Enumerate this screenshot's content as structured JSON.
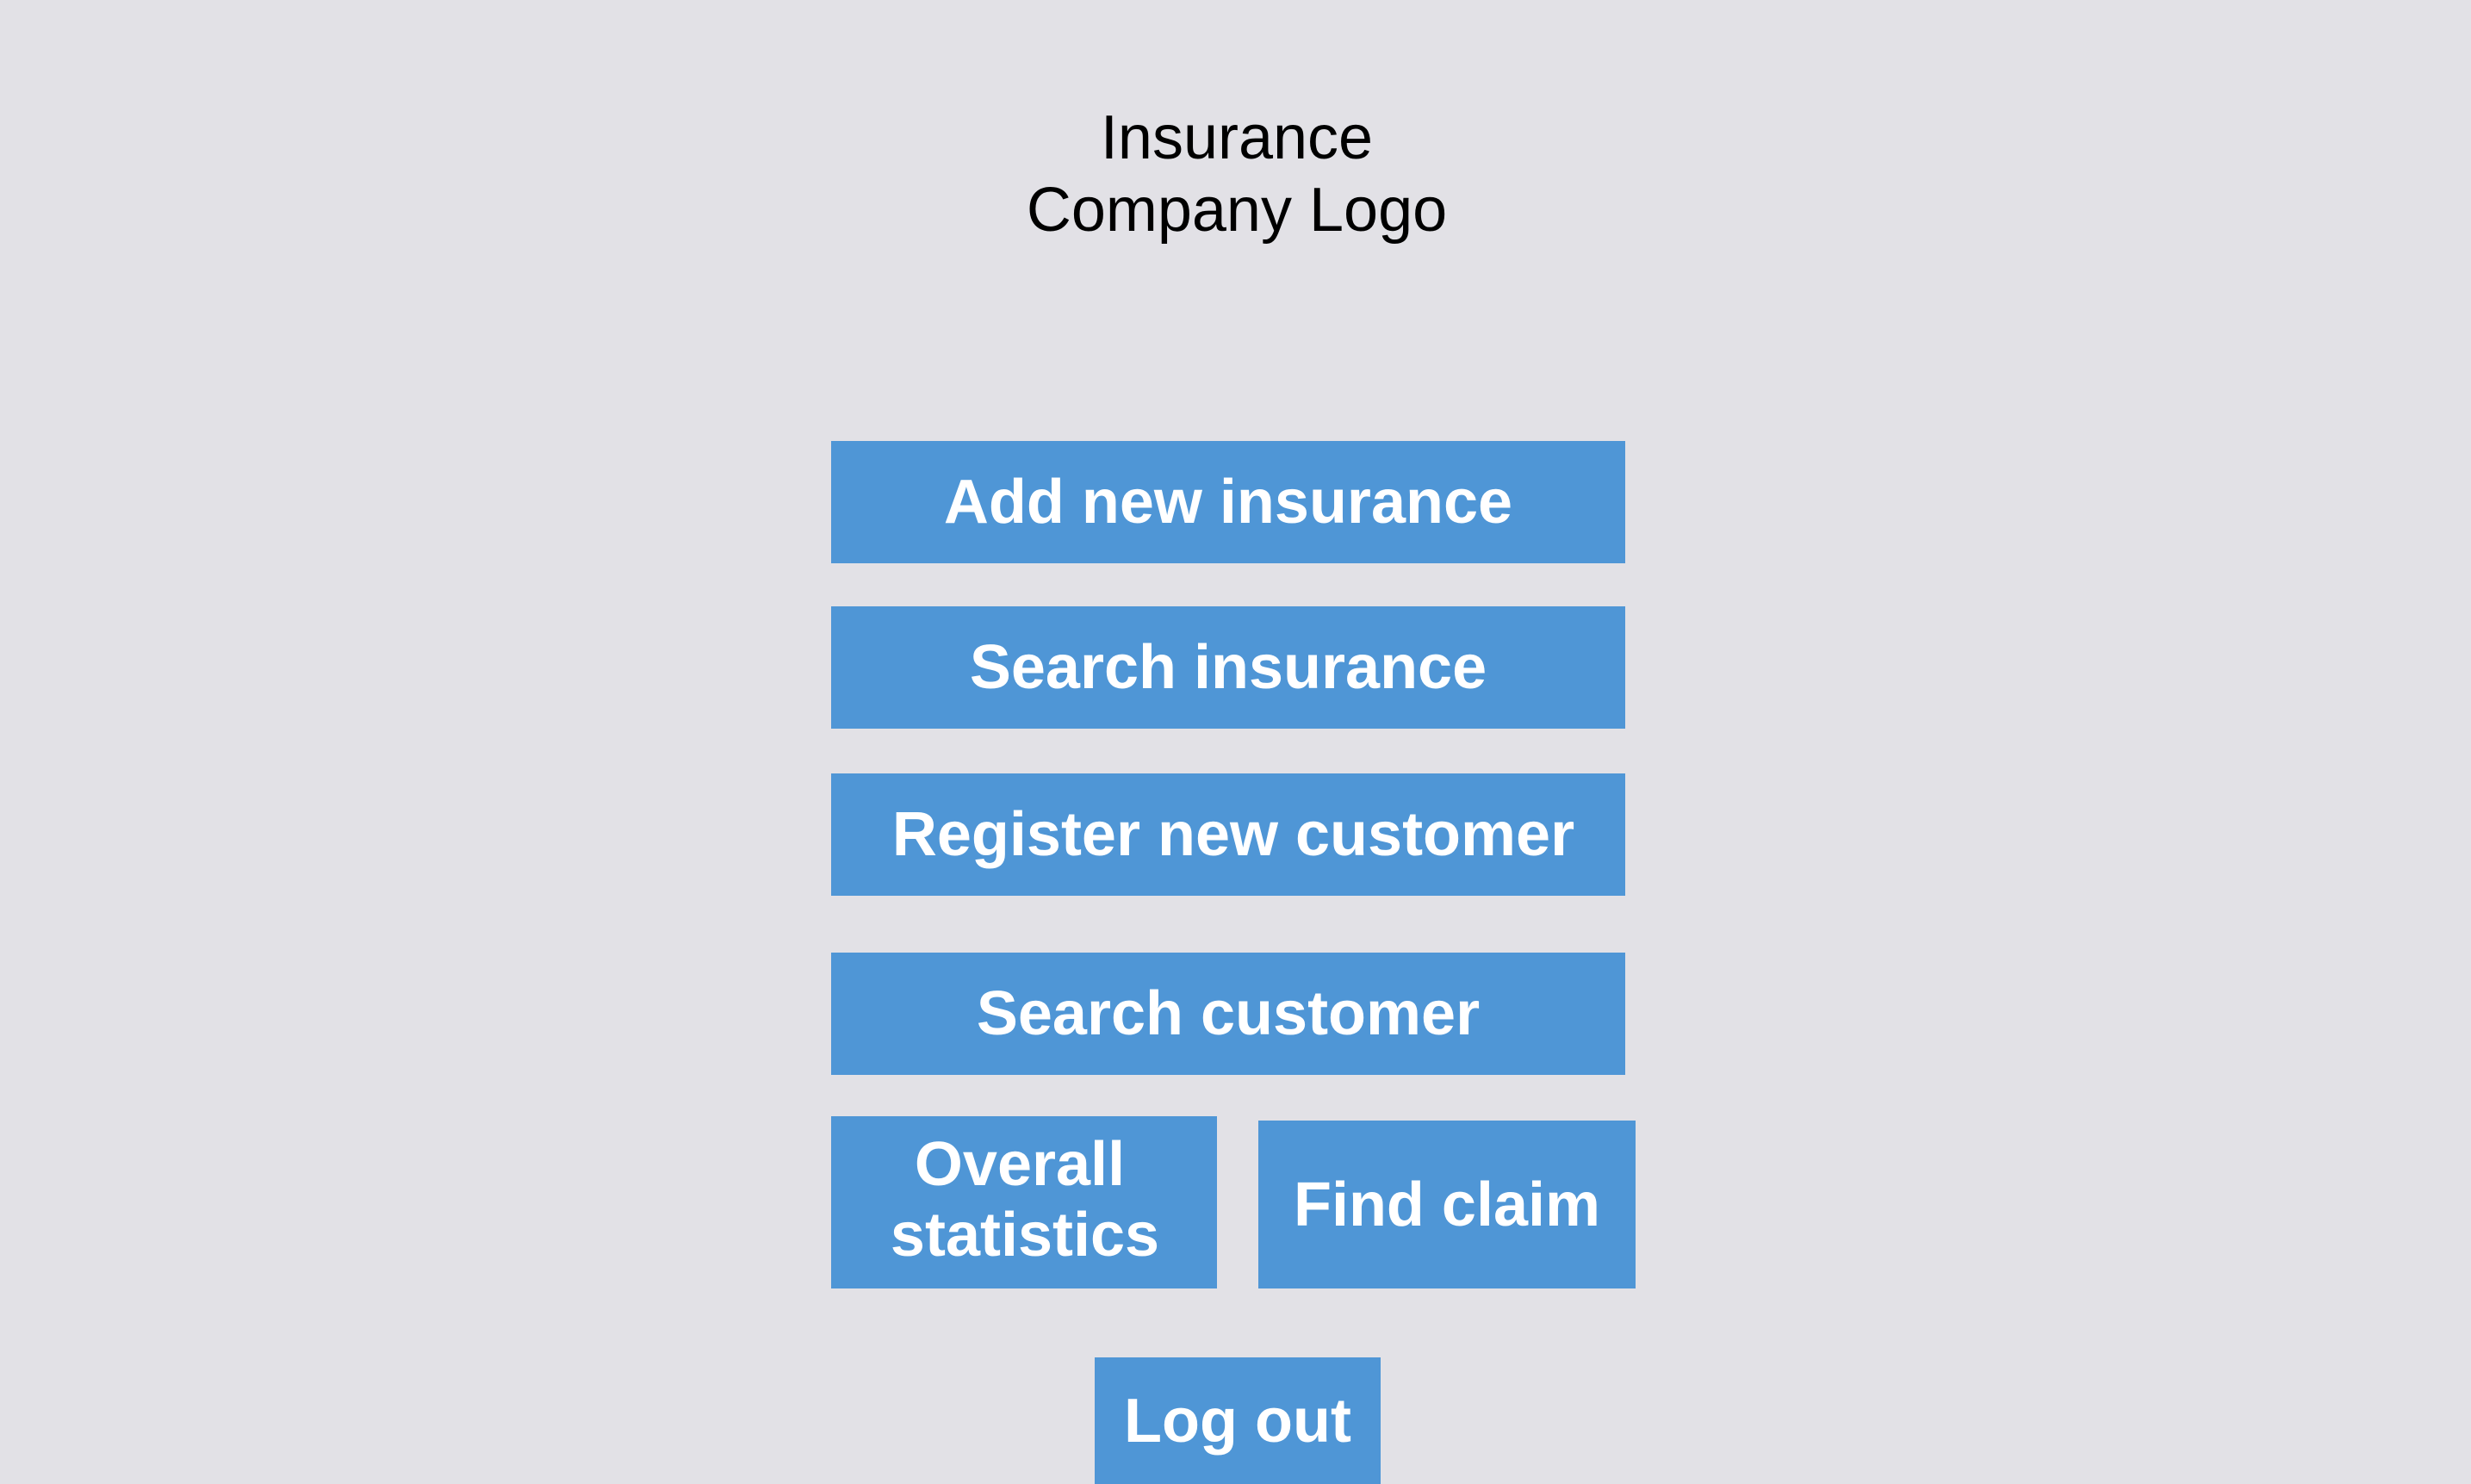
{
  "logo": {
    "line1": "Insurance",
    "line2": "Company Logo"
  },
  "menu": {
    "add_new_insurance": "Add new insurance",
    "search_insurance": "Search insurance",
    "register_new_customer": "Register new customer",
    "search_customer": "Search customer",
    "overall_statistics_line1": "Overall",
    "overall_statistics_line2": "statistics",
    "find_claim": "Find claim",
    "log_out": "Log out"
  },
  "colors": {
    "background": "#e2e1e6",
    "button": "#4f96d6",
    "button_text": "#ffffff",
    "logo_text": "#000000"
  }
}
